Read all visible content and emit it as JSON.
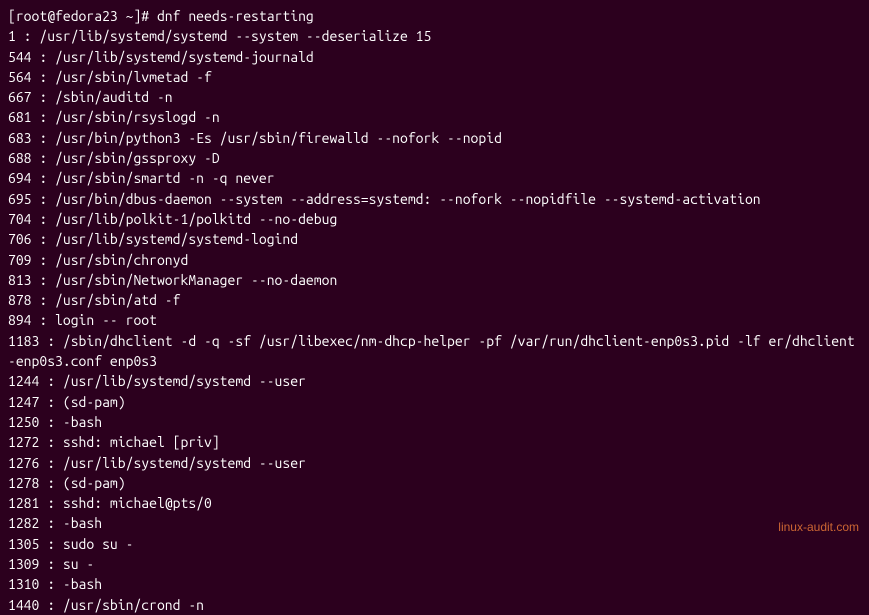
{
  "prompt": {
    "user_host": "[root@fedora23 ~]#",
    "command": "dnf needs-restarting"
  },
  "output_lines": [
    "1 : /usr/lib/systemd/systemd --system --deserialize 15",
    "544 : /usr/lib/systemd/systemd-journald",
    "564 : /usr/sbin/lvmetad -f",
    "667 : /sbin/auditd -n",
    "681 : /usr/sbin/rsyslogd -n",
    "683 : /usr/bin/python3 -Es /usr/sbin/firewalld --nofork --nopid",
    "688 : /usr/sbin/gssproxy -D",
    "694 : /usr/sbin/smartd -n -q never",
    "695 : /usr/bin/dbus-daemon --system --address=systemd: --nofork --nopidfile --systemd-activation",
    "704 : /usr/lib/polkit-1/polkitd --no-debug",
    "706 : /usr/lib/systemd/systemd-logind",
    "709 : /usr/sbin/chronyd",
    "813 : /usr/sbin/NetworkManager --no-daemon",
    "878 : /usr/sbin/atd -f",
    "894 : login -- root",
    "1183 : /sbin/dhclient -d -q -sf /usr/libexec/nm-dhcp-helper -pf /var/run/dhclient-enp0s3.pid -lf er/dhclient-enp0s3.conf enp0s3",
    "1244 : /usr/lib/systemd/systemd --user",
    "1247 : (sd-pam)",
    "1250 : -bash",
    "1272 : sshd: michael [priv]",
    "1276 : /usr/lib/systemd/systemd --user",
    "1278 : (sd-pam)",
    "1281 : sshd: michael@pts/0",
    "1282 : -bash",
    "1305 : sudo su -",
    "1309 : su -",
    "1310 : -bash",
    "1440 : /usr/sbin/crond -n"
  ],
  "watermark": "linux-audit.com"
}
